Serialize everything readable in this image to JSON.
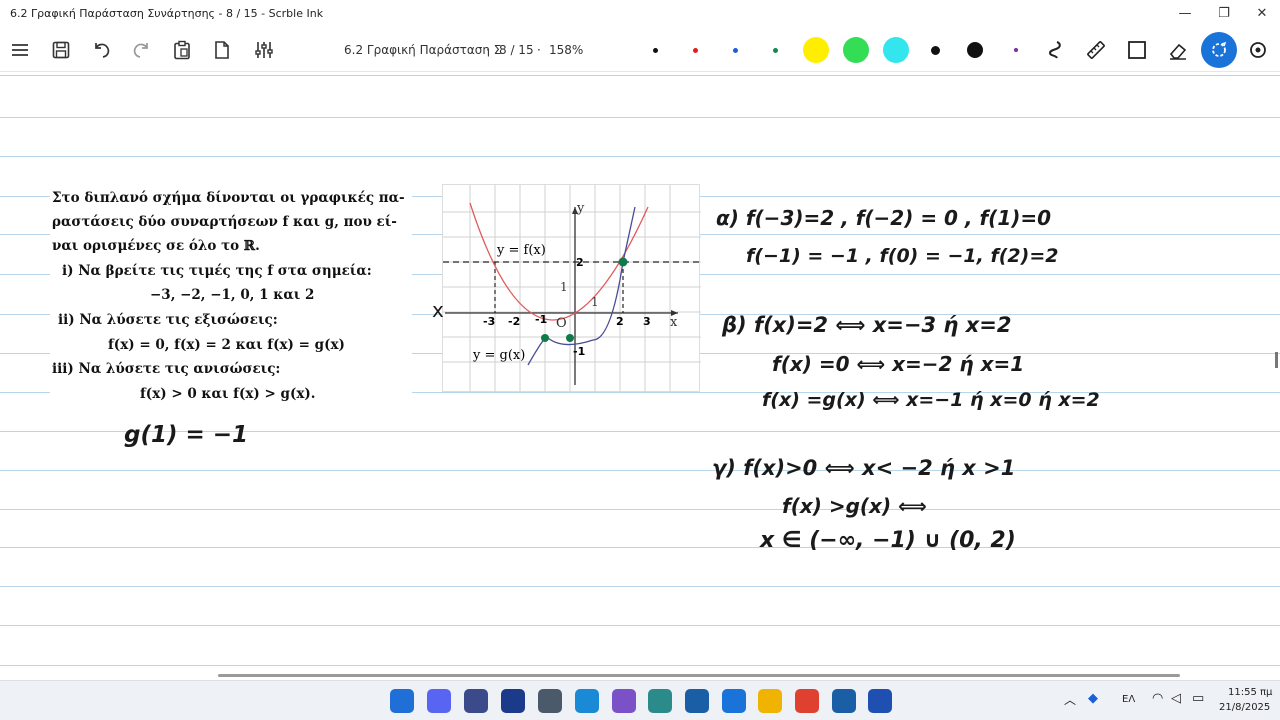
{
  "window": {
    "title": "6.2 Γραφική Παράσταση Συνάρτησης - 8 / 15 - Scrble Ink",
    "minimize": "—",
    "maximize": "❐",
    "close": "✕"
  },
  "toolbar": {
    "doc_name": "6.2 Γραφική Παράσταση Σ",
    "page_indicator": "8 / 15",
    "zoom": "158%",
    "left_tools": [
      "menu-icon",
      "save-icon",
      "undo-icon",
      "redo-icon",
      "paste-icon",
      "page-icon",
      "settings-sliders-icon"
    ],
    "pens": [
      {
        "name": "pen-black-small",
        "color": "#111111"
      },
      {
        "name": "pen-red-small",
        "color": "#e02020"
      },
      {
        "name": "pen-blue-small",
        "color": "#1f5fd6"
      },
      {
        "name": "pen-green-small",
        "color": "#138a4a"
      },
      {
        "name": "highlighter-yellow",
        "color": "#ffee00"
      },
      {
        "name": "highlighter-green",
        "color": "#33dd55"
      },
      {
        "name": "highlighter-cyan",
        "color": "#33e6ee"
      },
      {
        "name": "pen-black-medium",
        "color": "#111111"
      },
      {
        "name": "pen-black-large",
        "color": "#111111"
      },
      {
        "name": "pen-purple-small",
        "color": "#7a2ea0"
      }
    ],
    "right_tools": [
      "lasso-icon",
      "ruler-icon",
      "shape-icon",
      "eraser-icon",
      "selection-icon",
      "search-icon"
    ],
    "accent": "#1a73d9"
  },
  "problem": {
    "lines": [
      "Στο διπλανό σχήμα δίνονται οι γραφικές πα-",
      "ραστάσεις δύο συναρτήσεων f και g, που εί-",
      "ναι ορισμένες σε όλο το ℝ.",
      "i) Να βρείτε τις τιμές της f στα σημεία:",
      "−3, −2, −1, 0, 1 και 2",
      "ii) Να λύσετε τις εξισώσεις:",
      "f(x) = 0, f(x) = 2 και f(x) = g(x)",
      "iii) Να λύσετε τις ανισώσεις:",
      "f(x) > 0 και f(x) > g(x)."
    ]
  },
  "figure": {
    "f_label": "y = f(x)",
    "g_label": "y = g(x)",
    "x_axis": "x",
    "y_axis": "y",
    "origin": "O",
    "tick_one_x": "1",
    "tick_one_y": "1",
    "hand_ticks_x": [
      "-3",
      "-2",
      "-1",
      "2",
      "3"
    ],
    "hand_tick_y": "2",
    "hand_tick_neg": "-1",
    "margin_x": "x",
    "f_color": "#e05a5a",
    "g_color": "#4a4a9a",
    "point_color": "#0f7a4a"
  },
  "notes": {
    "g_value": "g(1) = −1",
    "a_line1": "α) f(−3)=2 , f(−2) = 0 , f(1)=0",
    "a_line2": "f(−1) = −1 , f(0) = −1, f(2)=2",
    "b_line1": "β) f(x)=2 ⟺ x=−3 ή x=2",
    "b_line2": "f(x) =0 ⟺ x=−2 ή x=1",
    "b_line3": "f(x) =g(x) ⟺ x=−1 ή x=0 ή x=2",
    "c_line1": "γ) f(x)>0 ⟺ x< −2 ή x >1",
    "c_line2": "f(x) >g(x) ⟺",
    "c_line3": "x ∈ (−∞, −1) ∪ (0, 2)"
  },
  "taskbar": {
    "apps": [
      {
        "name": "windows-start-icon",
        "color": "#1f6fd6"
      },
      {
        "name": "discord-icon",
        "color": "#5865f2"
      },
      {
        "name": "save-app-icon",
        "color": "#3a4a8a"
      },
      {
        "name": "clipchamp-icon",
        "color": "#1b3a8a"
      },
      {
        "name": "calculator-icon",
        "color": "#4a5a6a"
      },
      {
        "name": "edge-icon",
        "color": "#1b8ad6"
      },
      {
        "name": "viber-icon",
        "color": "#7b51c7"
      },
      {
        "name": "network-app-icon",
        "color": "#2b8a8a"
      },
      {
        "name": "math-app-icon",
        "color": "#1a5fa6"
      },
      {
        "name": "scrble-ink-icon",
        "color": "#1a73d9"
      },
      {
        "name": "file-explorer-icon",
        "color": "#f0b400"
      },
      {
        "name": "chrome-icon",
        "color": "#e04030"
      },
      {
        "name": "math-app-2-icon",
        "color": "#1a5fa6"
      },
      {
        "name": "word-icon",
        "color": "#1f4fb0"
      }
    ],
    "language": "ΕΛ",
    "time": "11:55 πμ",
    "date": "21/8/2025"
  }
}
